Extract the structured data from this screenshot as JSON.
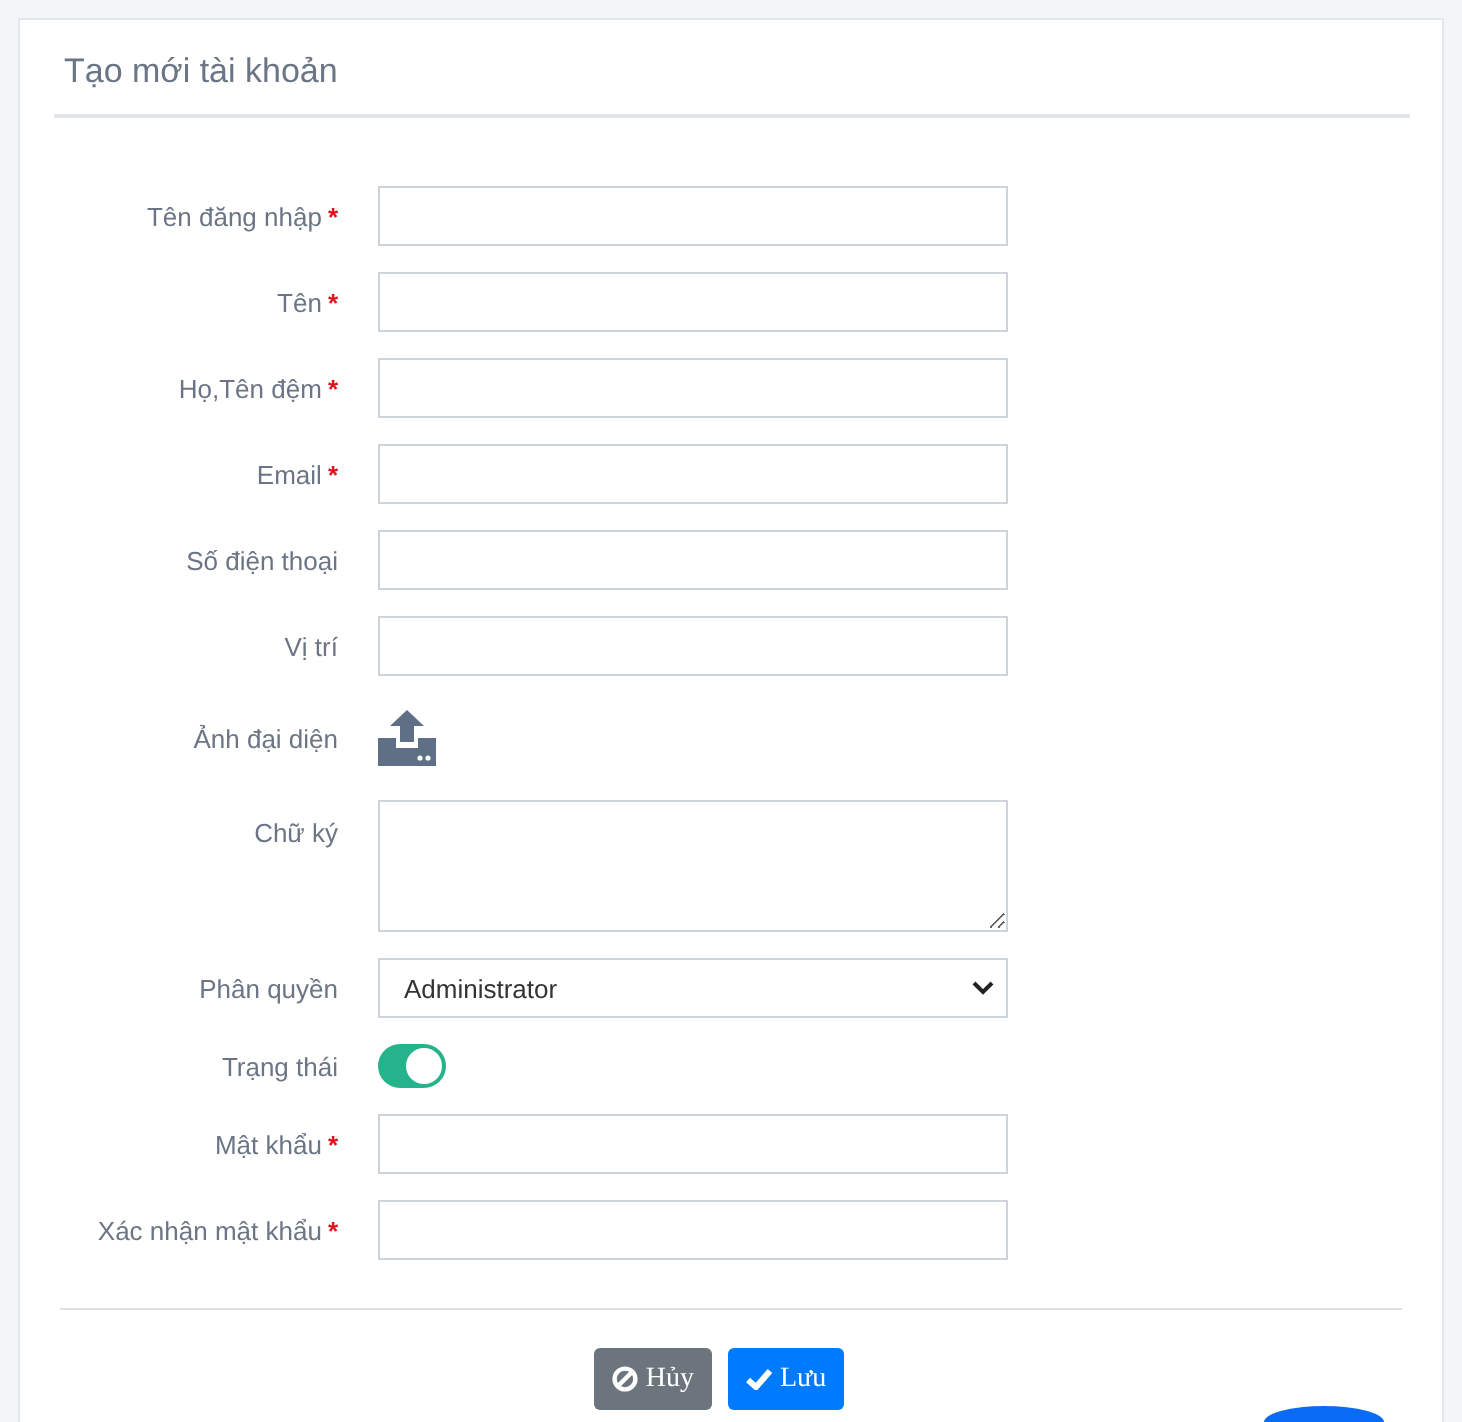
{
  "title": "Tạo mới tài khoản",
  "fields": [
    {
      "kind": "text",
      "label": "Tên đăng nhập",
      "required": true
    },
    {
      "kind": "text",
      "label": "Tên",
      "required": true
    },
    {
      "kind": "text",
      "label": "Họ,Tên đệm",
      "required": true
    },
    {
      "kind": "text",
      "label": "Email",
      "required": true
    },
    {
      "kind": "text",
      "label": "Số điện thoại",
      "required": false
    },
    {
      "kind": "text",
      "label": "Vị trí",
      "required": false
    },
    {
      "kind": "upload",
      "label": "Ảnh đại diện",
      "required": false
    },
    {
      "kind": "textarea",
      "label": "Chữ ký",
      "required": false
    },
    {
      "kind": "select",
      "label": "Phân quyền",
      "required": false,
      "value": "Administrator"
    },
    {
      "kind": "toggle",
      "label": "Trạng thái",
      "required": false,
      "on": true
    },
    {
      "kind": "password",
      "label": "Mật khẩu",
      "required": true
    },
    {
      "kind": "password",
      "label": "Xác nhận mật khẩu",
      "required": true
    }
  ],
  "buttons": [
    {
      "kind": "cancel",
      "label": "Hủy"
    },
    {
      "kind": "save",
      "label": "Lưu"
    }
  ],
  "required_mark": "*"
}
